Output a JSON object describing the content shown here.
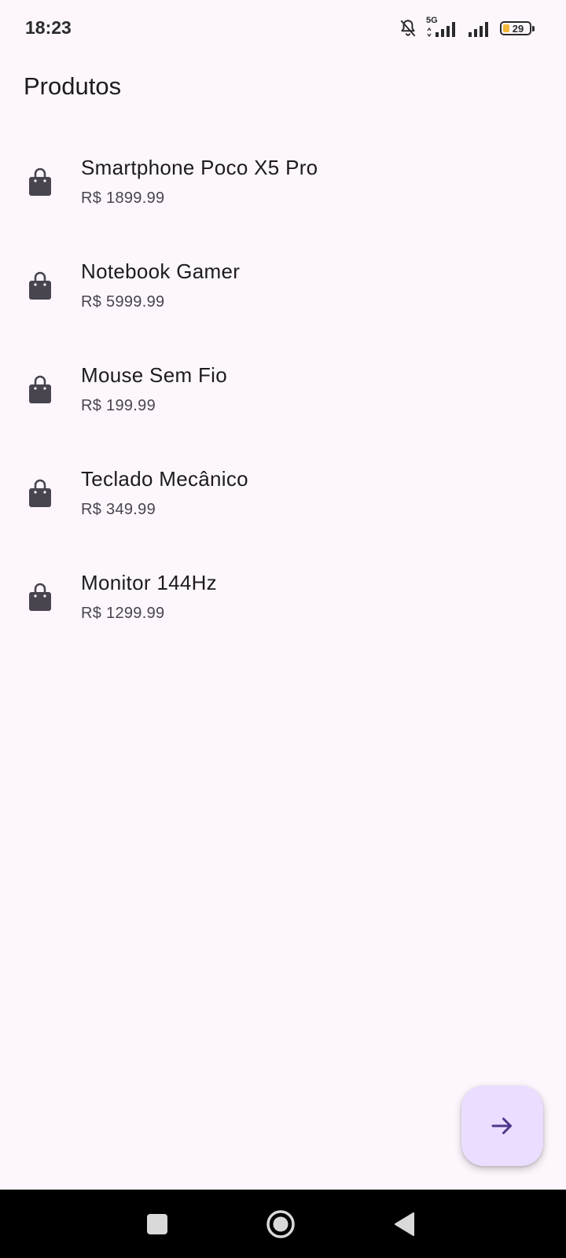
{
  "status_bar": {
    "time": "18:23",
    "network_label": "5G",
    "battery_level": "29",
    "icons": [
      "bell-off-icon",
      "signal-5g-icon",
      "signal-icon",
      "battery-icon"
    ]
  },
  "app_bar": {
    "title": "Produtos"
  },
  "products": [
    {
      "name": "Smartphone Poco X5 Pro",
      "price": "R$ 1899.99",
      "icon": "shopping-bag-icon"
    },
    {
      "name": "Notebook Gamer",
      "price": "R$ 5999.99",
      "icon": "shopping-bag-icon"
    },
    {
      "name": "Mouse Sem Fio",
      "price": "R$ 199.99",
      "icon": "shopping-bag-icon"
    },
    {
      "name": "Teclado Mecânico",
      "price": "R$ 349.99",
      "icon": "shopping-bag-icon"
    },
    {
      "name": "Monitor 144Hz",
      "price": "R$ 1299.99",
      "icon": "shopping-bag-icon"
    }
  ],
  "fab": {
    "icon": "arrow-forward-icon"
  },
  "nav_bar": {
    "buttons": [
      "recents-square-icon",
      "home-circle-icon",
      "back-triangle-icon"
    ]
  },
  "colors": {
    "background": "#fdf7fd",
    "fab_background": "#eaddff",
    "fab_icon": "#4f378b",
    "icon": "#49454f",
    "battery_fill": "#f3b73a"
  }
}
